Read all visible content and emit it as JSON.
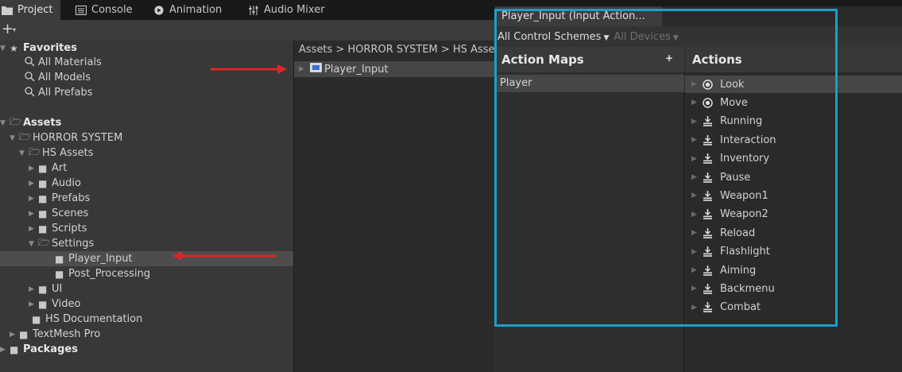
{
  "tabs": [
    {
      "label": "Project",
      "icon": "folder-icon"
    },
    {
      "label": "Console",
      "icon": "console-icon"
    },
    {
      "label": "Animation",
      "icon": "animation-icon"
    },
    {
      "label": "Audio Mixer",
      "icon": "audio-mixer-icon"
    }
  ],
  "toolbar": {
    "add_label": "+",
    "add_caret": "▾"
  },
  "tree": {
    "favorites": {
      "label": "Favorites",
      "items": [
        "All Materials",
        "All Models",
        "All Prefabs"
      ]
    },
    "assets_label": "Assets",
    "horror_system": "HORROR SYSTEM",
    "hs_assets": "HS Assets",
    "folders": [
      "Art",
      "Audio",
      "Prefabs",
      "Scenes",
      "Scripts"
    ],
    "settings": "Settings",
    "settings_children": [
      "Player_Input",
      "Post_Processing"
    ],
    "more_folders": [
      "UI",
      "Video"
    ],
    "hs_documentation": "HS Documentation",
    "textmesh_pro": "TextMesh Pro",
    "packages": "Packages"
  },
  "assets_panel": {
    "breadcrumb": "Assets > HORROR SYSTEM > HS Assets",
    "item": "Player_Input"
  },
  "input_actions": {
    "tab_title": "Player_Input (Input Action...",
    "control_scheme": "All Control Schemes",
    "devices": "All Devices",
    "maps_title": "Action Maps",
    "maps_add": "+",
    "maps": [
      "Player"
    ],
    "actions_title": "Actions",
    "actions": [
      {
        "label": "Look",
        "icon": "value-action-icon"
      },
      {
        "label": "Move",
        "icon": "value-action-icon"
      },
      {
        "label": "Running",
        "icon": "button-action-icon"
      },
      {
        "label": "Interaction",
        "icon": "button-action-icon"
      },
      {
        "label": "Inventory",
        "icon": "button-action-icon"
      },
      {
        "label": "Pause",
        "icon": "button-action-icon"
      },
      {
        "label": "Weapon1",
        "icon": "button-action-icon"
      },
      {
        "label": "Weapon2",
        "icon": "button-action-icon"
      },
      {
        "label": "Reload",
        "icon": "button-action-icon"
      },
      {
        "label": "Flashlight",
        "icon": "button-action-icon"
      },
      {
        "label": "Aiming",
        "icon": "button-action-icon"
      },
      {
        "label": "Backmenu",
        "icon": "button-action-icon"
      },
      {
        "label": "Combat",
        "icon": "button-action-icon"
      }
    ]
  },
  "colors": {
    "highlight_box": "#1aa0c8",
    "arrow": "#e02424"
  }
}
